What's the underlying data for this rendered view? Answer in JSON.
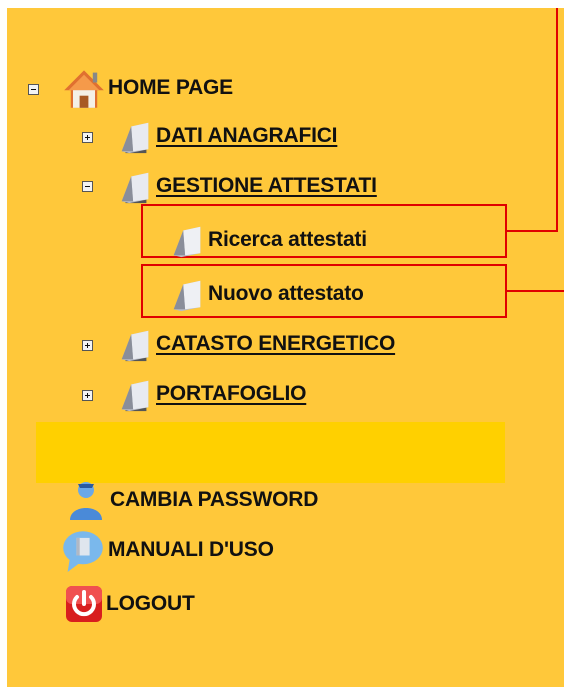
{
  "menu": {
    "home": {
      "label": "HOME PAGE",
      "icon": "home-icon"
    },
    "items": [
      {
        "label": "DATI ANAGRAFICI",
        "icon": "folder-icon",
        "state": "collapsed"
      },
      {
        "label": "GESTIONE ATTESTATI",
        "icon": "folder-icon",
        "state": "expanded",
        "children": [
          {
            "label": "Ricerca attestati",
            "icon": "folder-icon"
          },
          {
            "label": "Nuovo attestato",
            "icon": "folder-icon"
          }
        ]
      },
      {
        "label": "CATASTO ENERGETICO",
        "icon": "folder-icon",
        "state": "collapsed"
      },
      {
        "label": "PORTAFOGLIO",
        "icon": "folder-icon",
        "state": "collapsed"
      }
    ],
    "extra": [
      {
        "label": "CAMBIA PASSWORD",
        "icon": "user-icon"
      },
      {
        "label": "MANUALI D'USO",
        "icon": "chat-bubble-icon"
      },
      {
        "label": "LOGOUT",
        "icon": "power-icon"
      }
    ]
  },
  "colors": {
    "panel": "#ffc83a",
    "bar": "#ffd000",
    "annotation": "#e00000"
  }
}
